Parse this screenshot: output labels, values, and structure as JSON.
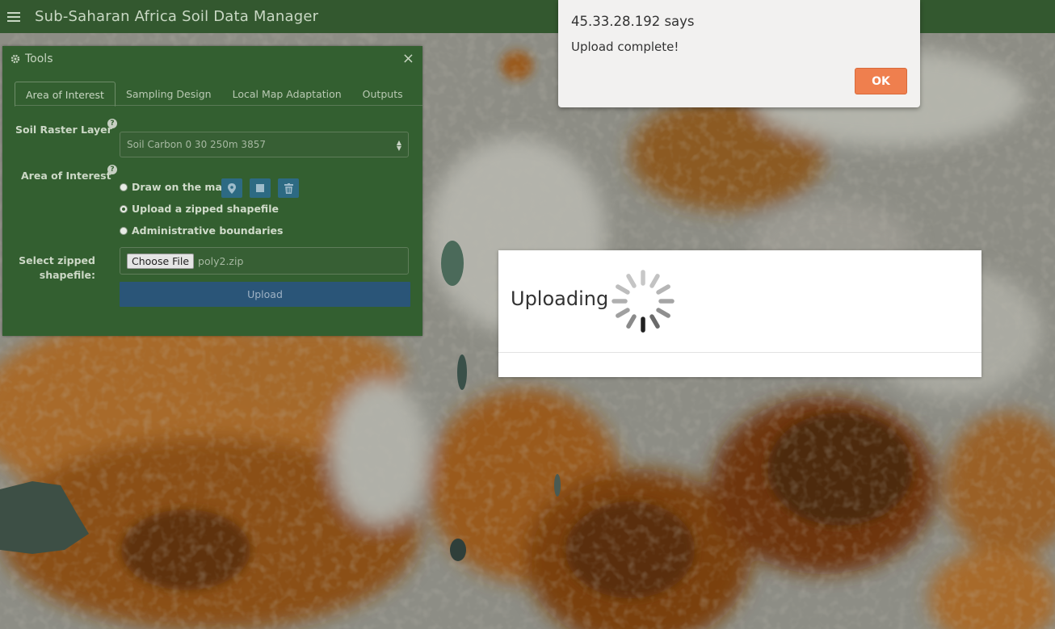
{
  "header": {
    "title": "Sub-Saharan Africa Soil Data Manager",
    "menu_icon": "hamburger-menu-icon"
  },
  "tools": {
    "title": "Tools",
    "close": "×",
    "tabs": [
      "Area of Interest",
      "Sampling Design",
      "Local Map Adaptation",
      "Outputs"
    ],
    "active_tab": "Area of Interest",
    "soil_raster_label": "Soil Raster Layer",
    "soil_raster_value": "Soil Carbon 0 30 250m 3857",
    "aoi_label": "Area of Interest",
    "help_glyph": "?",
    "radio_options": [
      "Draw on the map",
      "Upload a zipped shapefile",
      "Administrative boundaries"
    ],
    "selected_option": "Upload a zipped shapefile",
    "draw_tools": [
      "map-marker-icon",
      "square-icon",
      "trash-icon"
    ],
    "select_shapefile_label_1": "Select zipped",
    "select_shapefile_label_2": "shapefile:",
    "choose_file_label": "Choose File",
    "file_name": "poly2.zip",
    "upload_label": "Upload"
  },
  "modal": {
    "text": "Uploading"
  },
  "alert": {
    "title": "45.33.28.192 says",
    "message": "Upload complete!",
    "ok_label": "OK",
    "ok_color": "#ef7f4e"
  },
  "colors": {
    "header": "#33582f",
    "panel": "#335f30",
    "upload_button": "#2a5578",
    "tool_button": "#2d6a83"
  }
}
